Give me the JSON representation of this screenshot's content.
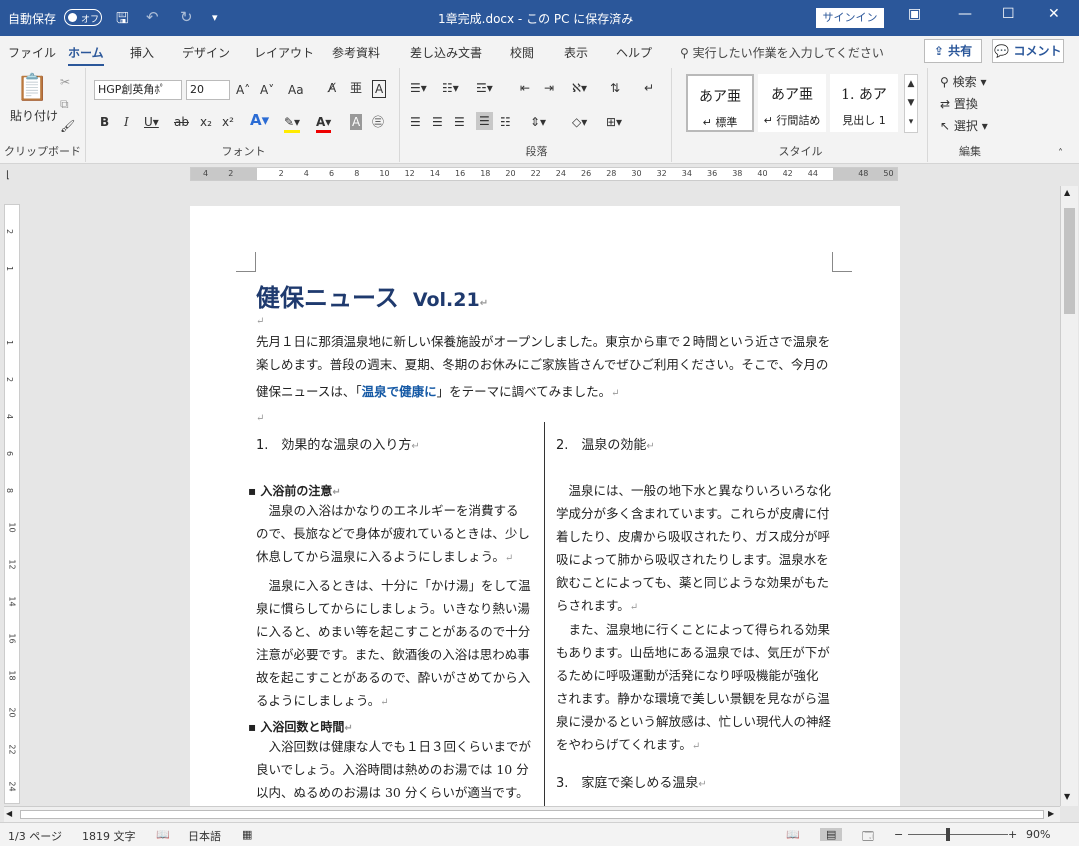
{
  "titlebar": {
    "autosave_label": "自動保存",
    "autosave_state": "オフ",
    "doc_title": "1章完成.docx - この PC に保存済み",
    "signin": "サインイン"
  },
  "tabs": [
    "ファイル",
    "ホーム",
    "挿入",
    "デザイン",
    "レイアウト",
    "参考資料",
    "差し込み文書",
    "校閲",
    "表示",
    "ヘルプ"
  ],
  "search_placeholder": "実行したい作業を入力してください",
  "share": "共有",
  "comment": "コメント",
  "ribbon": {
    "clipboard": {
      "paste": "貼り付け",
      "label": "クリップボード"
    },
    "font": {
      "name": "HGP創英角ﾎﾟ",
      "size": "20",
      "label": "フォント",
      "aa": "Aa"
    },
    "paragraph": {
      "label": "段落"
    },
    "styles": {
      "items": [
        {
          "preview": "あア亜",
          "name": "↵ 標準"
        },
        {
          "preview": "あア亜",
          "name": "↵ 行間詰め"
        },
        {
          "preview": "1. あア",
          "name": "見出し 1"
        }
      ],
      "label": "スタイル"
    },
    "editing": {
      "search": "検索",
      "replace": "置換",
      "select": "選択",
      "label": "編集"
    }
  },
  "ruler_ticks": [
    "4",
    "2",
    "",
    "2",
    "4",
    "6",
    "8",
    "10",
    "12",
    "14",
    "16",
    "18",
    "20",
    "22",
    "24",
    "26",
    "28",
    "30",
    "32",
    "34",
    "36",
    "38",
    "40",
    "42",
    "44",
    "",
    "48",
    "50"
  ],
  "vruler_ticks": [
    "2",
    "1",
    "",
    "1",
    "2",
    "4",
    "6",
    "8",
    "10",
    "12",
    "14",
    "16",
    "18",
    "20",
    "22",
    "24"
  ],
  "document": {
    "title": "健保ニュース",
    "vol": "Vol.21",
    "intro1": "先月１日に那須温泉地に新しい保養施設がオープンしました。東京から車で２時間という近さで温泉を",
    "intro2": "楽しめます。普段の週末、夏期、冬期のお休みにご家族皆さんでぜひご利用ください。そこで、今月の",
    "intro3a": "健保ニュースは、「",
    "intro3b": "温泉で健康に",
    "intro3c": "」をテーマに調べてみました。",
    "col1": {
      "sec1": "1.　効果的な温泉の入り方",
      "b1": "入浴前の注意",
      "p1": [
        "　温泉の入浴はかなりのエネルギーを消費する",
        "ので、長旅などで身体が疲れているときは、少し",
        "休息してから温泉に入るようにしましょう。"
      ],
      "p2": [
        "　温泉に入るときは、十分に「かけ湯」をして温",
        "泉に慣らしてからにしましょう。いきなり熱い湯",
        "に入ると、めまい等を起こすことがあるので十分",
        "注意が必要です。また、飲酒後の入浴は思わぬ事",
        "故を起こすことがあるので、酔いがさめてから入",
        "るようにしましょう。"
      ],
      "b2": "入浴回数と時間",
      "p3": [
        "　入浴回数は健康な人でも１日３回くらいまでが",
        "良いでしょう。入浴時間は熱めのお湯では 10 分",
        "以内、ぬるめのお湯は 30 分くらいが適当です。"
      ]
    },
    "col2": {
      "sec2": "2.　温泉の効能",
      "p1": [
        "　温泉には、一般の地下水と異なりいろいろな化",
        "学成分が多く含まれています。これらが皮膚に付",
        "着したり、皮膚から吸収されたり、ガス成分が呼",
        "吸によって肺から吸収されたりします。温泉水を",
        "飲むことによっても、薬と同じような効果がもた",
        "らされます。"
      ],
      "p2": [
        "　また、温泉地に行くことによって得られる効果",
        "もあります。山岳地にある温泉では、気圧が下が",
        "るために呼吸運動が活発になり呼吸機能が強化",
        "されます。静かな環境で美しい景観を見ながら温",
        "泉に浸かるという解放感は、忙しい現代人の神経",
        "をやわらげてくれます。"
      ],
      "sec3": "3.　家庭で楽しめる温泉"
    }
  },
  "status": {
    "page": "1/3 ページ",
    "words": "1819 文字",
    "lang": "日本語",
    "zoom": "90%"
  }
}
